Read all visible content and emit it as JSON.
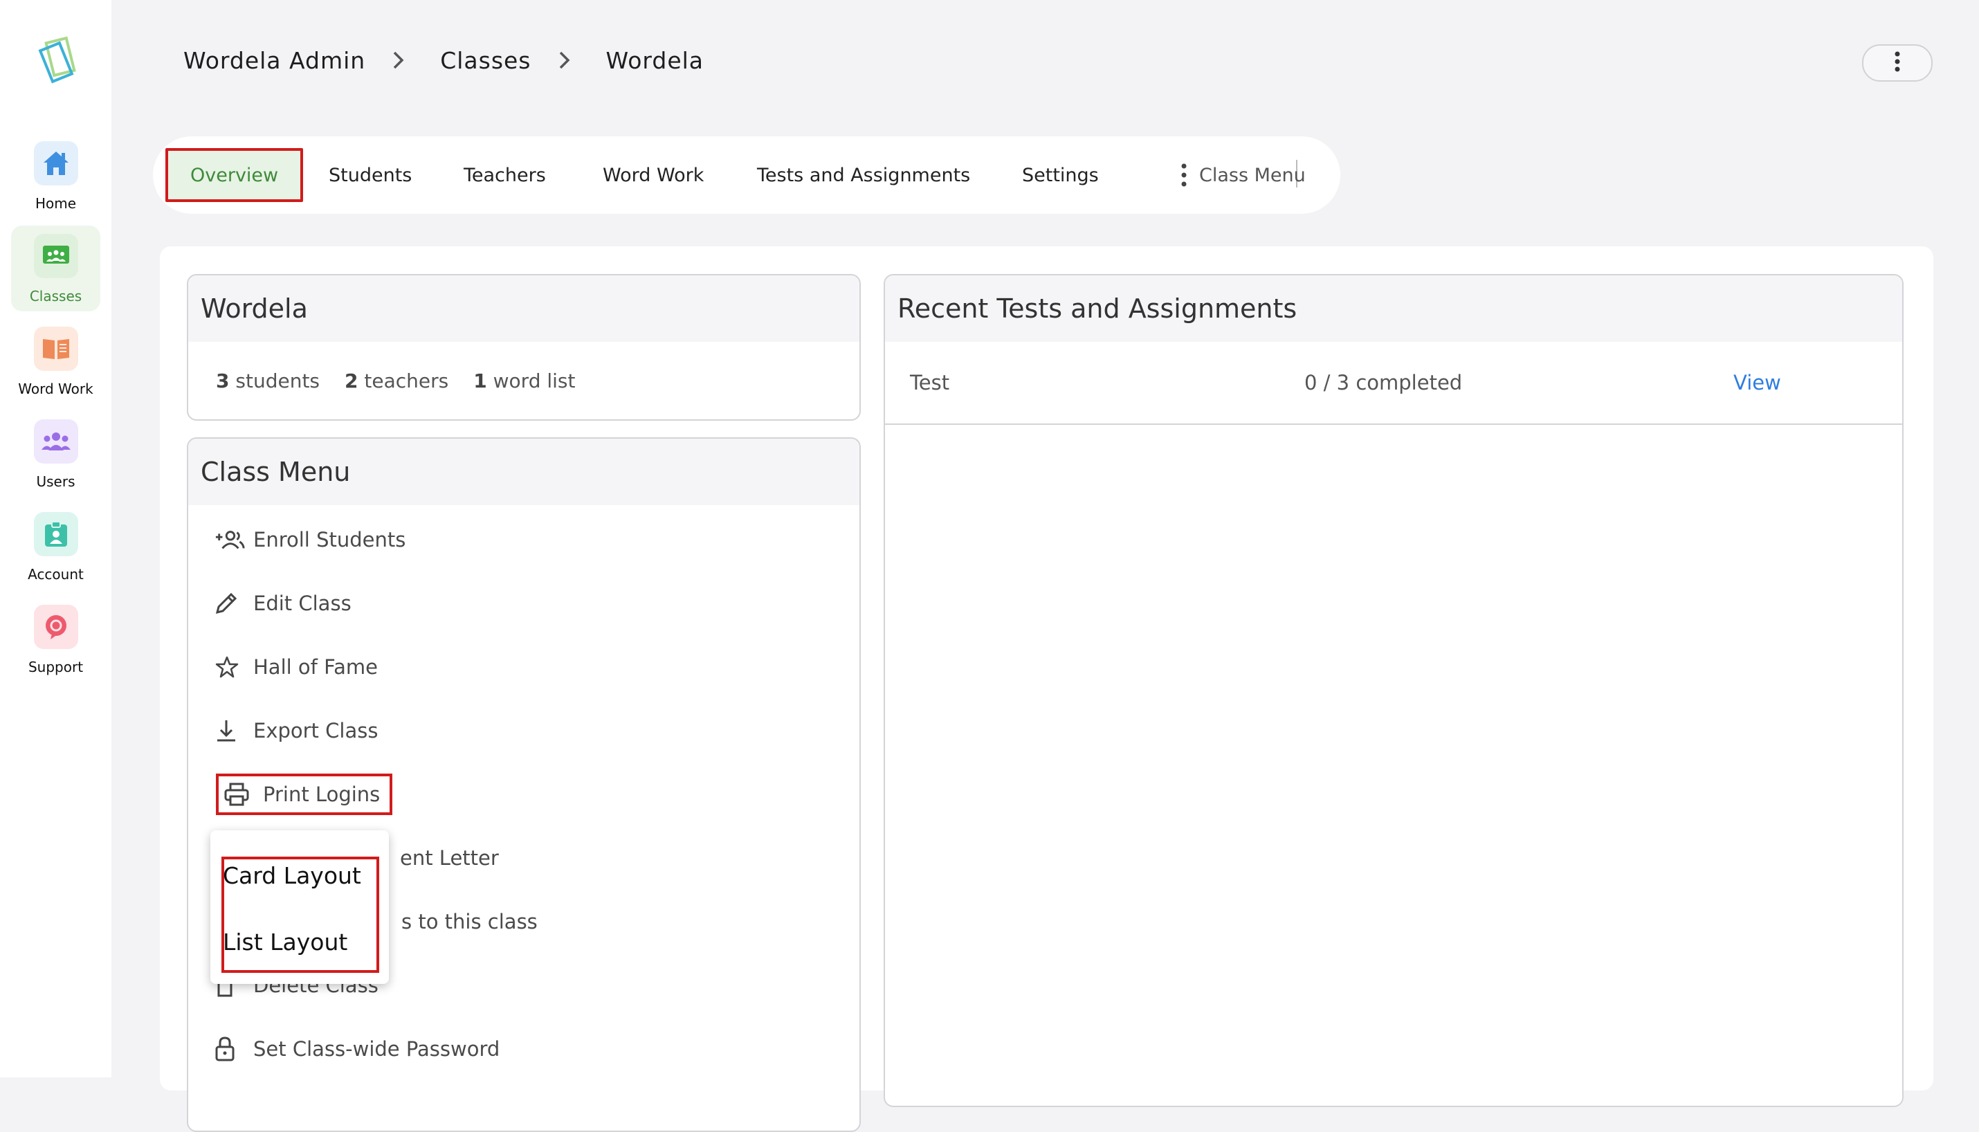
{
  "app": {
    "name": "Wordela",
    "logo_icon": "wordela-logo-icon"
  },
  "sidebar": {
    "items": [
      {
        "label": "Home",
        "icon": "home-icon",
        "color": "#3f8fe0",
        "bg": "#e3f0fb"
      },
      {
        "label": "Classes",
        "icon": "classroom-icon",
        "color": "#3fae45",
        "bg": "#dff0dc",
        "active": true
      },
      {
        "label": "Word Work",
        "icon": "book-icon",
        "color": "#ee8a57",
        "bg": "#fde9de"
      },
      {
        "label": "Users",
        "icon": "users-icon",
        "color": "#9a6ee6",
        "bg": "#efe7fc"
      },
      {
        "label": "Account",
        "icon": "badge-icon",
        "color": "#3cc1a8",
        "bg": "#ddf5ef"
      },
      {
        "label": "Support",
        "icon": "support-icon",
        "color": "#ee5a6d",
        "bg": "#fde2e6"
      }
    ]
  },
  "breadcrumb": [
    "Wordela Admin",
    "Classes",
    "Wordela"
  ],
  "tabs": [
    {
      "label": "Overview",
      "active": true
    },
    {
      "label": "Students"
    },
    {
      "label": "Teachers"
    },
    {
      "label": "Word Work"
    },
    {
      "label": "Tests and Assignments"
    },
    {
      "label": "Settings"
    }
  ],
  "class_menu_tab": "Class Menu",
  "class_card": {
    "title": "Wordela",
    "stats": [
      {
        "count": "3",
        "label": "students"
      },
      {
        "count": "2",
        "label": "teachers"
      },
      {
        "count": "1",
        "label": "word list"
      }
    ]
  },
  "class_menu": {
    "title": "Class Menu",
    "items": [
      {
        "label": "Enroll Students",
        "icon": "add-people-icon"
      },
      {
        "label": "Edit Class",
        "icon": "pencil-icon"
      },
      {
        "label": "Hall of Fame",
        "icon": "star-icon"
      },
      {
        "label": "Export Class",
        "icon": "download-icon"
      },
      {
        "label": "Print Logins",
        "icon": "printer-icon"
      },
      {
        "label": "ent Letter",
        "icon": "letter-icon"
      },
      {
        "label": "s to this class",
        "icon": "link-icon"
      },
      {
        "label": "Delete Class",
        "icon": "trash-icon"
      },
      {
        "label": "Set Class-wide Password",
        "icon": "lock-icon"
      }
    ]
  },
  "print_popup": {
    "options": [
      "Card Layout",
      "List Layout"
    ]
  },
  "recent": {
    "title": "Recent Tests and Assignments",
    "rows": [
      {
        "name": "Test",
        "progress": "0 / 3 completed",
        "action": "View"
      }
    ]
  },
  "colors": {
    "accent": "#3f8a3a",
    "highlight": "#d21b1b",
    "link": "#2f7de0"
  }
}
